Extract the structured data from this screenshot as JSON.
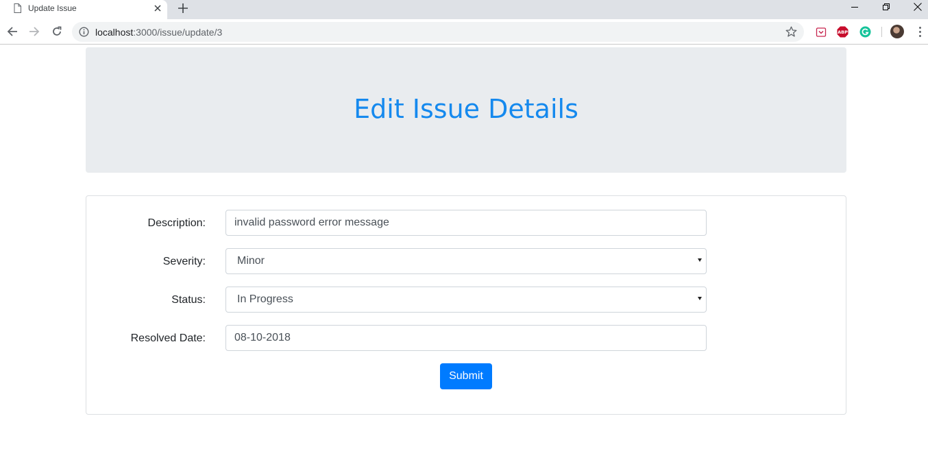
{
  "browser": {
    "tab_title": "Update Issue",
    "url_host": "localhost",
    "url_path": ":3000/issue/update/3"
  },
  "page": {
    "heading": "Edit Issue Details"
  },
  "form": {
    "description_label": "Description:",
    "description_value": "invalid password error message",
    "severity_label": "Severity:",
    "severity_value": "Minor",
    "status_label": "Status:",
    "status_value": "In Progress",
    "resolved_date_label": "Resolved Date:",
    "resolved_date_value": "08-10-2018",
    "submit_label": "Submit"
  },
  "icons": {
    "tab": "document-icon",
    "tab_close": "close-icon",
    "new_tab": "plus-icon",
    "back": "arrow-left-icon",
    "forward": "arrow-right-icon",
    "reload": "reload-icon",
    "site_info": "info-icon",
    "bookmark": "star-icon",
    "extensions": [
      "pocket-icon",
      "adblock-plus-icon",
      "grammarly-icon"
    ],
    "menu": "kebab-menu-icon"
  },
  "colors": {
    "heading": "#1589ee",
    "primary_button": "#007bff",
    "jumbotron_bg": "#e9ecef",
    "abp_red": "#c70d2c",
    "grammarly_green": "#15c39a"
  }
}
